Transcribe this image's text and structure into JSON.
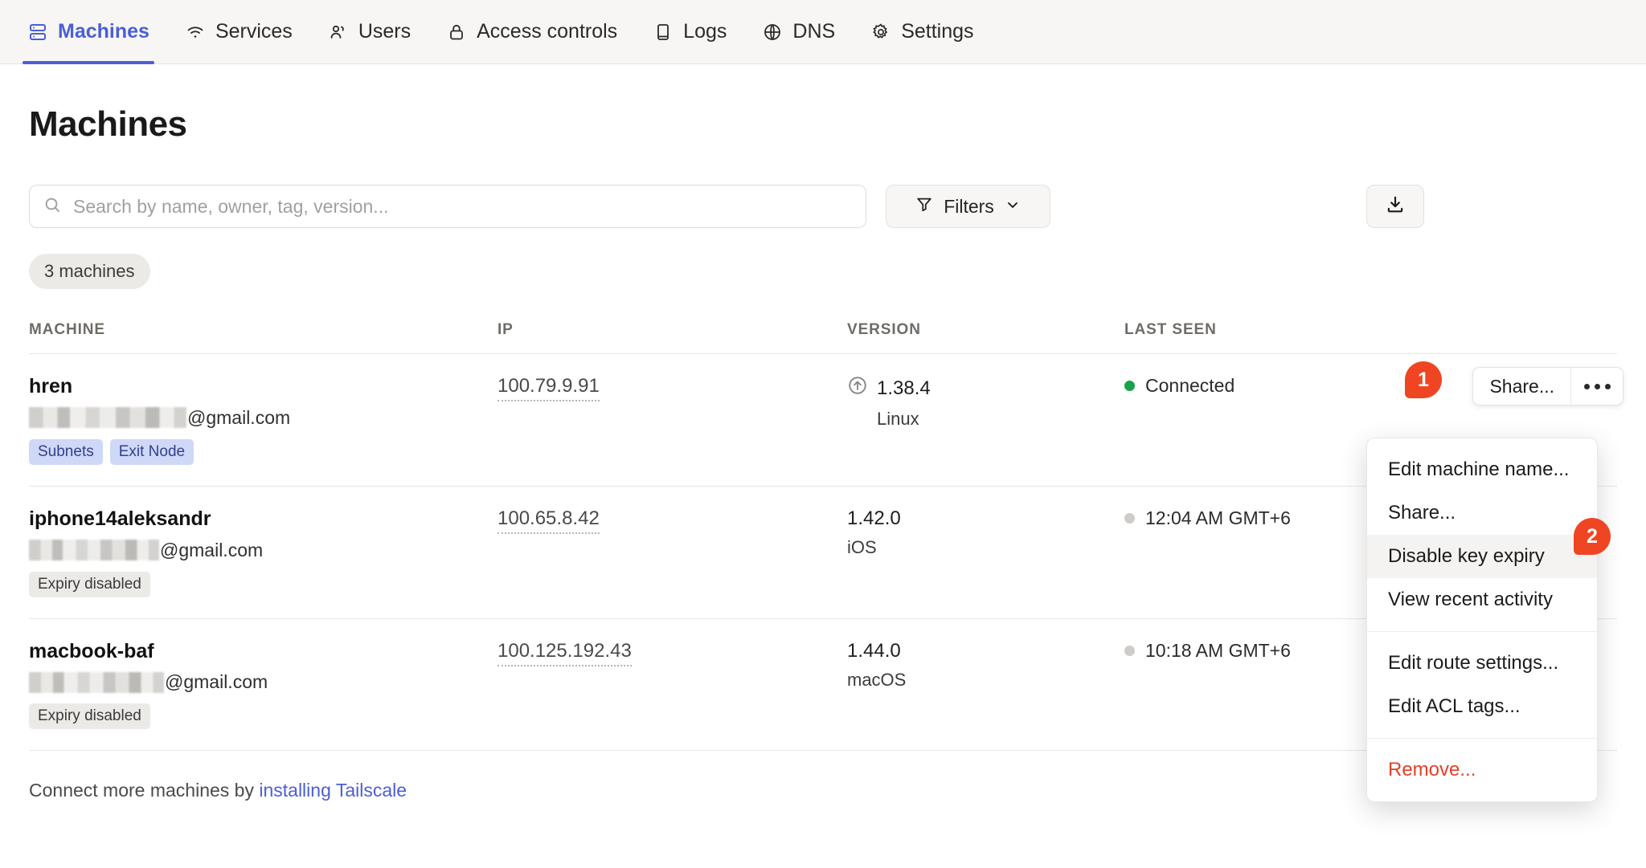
{
  "nav": {
    "items": [
      {
        "label": "Machines",
        "icon": "server-icon",
        "active": true
      },
      {
        "label": "Services",
        "icon": "wifi-icon",
        "active": false
      },
      {
        "label": "Users",
        "icon": "users-icon",
        "active": false
      },
      {
        "label": "Access controls",
        "icon": "lock-icon",
        "active": false
      },
      {
        "label": "Logs",
        "icon": "book-icon",
        "active": false
      },
      {
        "label": "DNS",
        "icon": "globe-icon",
        "active": false
      },
      {
        "label": "Settings",
        "icon": "gear-icon",
        "active": false
      }
    ],
    "accent_color": "#4b5ed7"
  },
  "page": {
    "title": "Machines"
  },
  "search": {
    "placeholder": "Search by name, owner, tag, version...",
    "value": "",
    "icon": "search-icon"
  },
  "filters": {
    "label": "Filters",
    "icon": "funnel-icon",
    "chevron": "chevron-down-icon"
  },
  "download": {
    "icon": "download-icon",
    "label": ""
  },
  "count_chip": {
    "label": "3 machines"
  },
  "table": {
    "headers": [
      "MACHINE",
      "IP",
      "VERSION",
      "LAST SEEN"
    ],
    "rows": [
      {
        "name": "hren",
        "owner_domain": "@gmail.com",
        "owner_redacted": true,
        "tags": [
          {
            "label": "Subnets",
            "style": "blue"
          },
          {
            "label": "Exit Node",
            "style": "blue"
          }
        ],
        "ip": "100.79.9.91",
        "version": "1.38.4",
        "version_update_icon": "arrow-up-circle-icon",
        "os": "Linux",
        "last_seen": "Connected",
        "status": "connected",
        "status_color": "#17a34a",
        "has_actions": true,
        "share_label": "Share..."
      },
      {
        "name": "iphone14aleksandr",
        "owner_domain": "@gmail.com",
        "owner_redacted": true,
        "tags": [
          {
            "label": "Expiry disabled",
            "style": "gray"
          }
        ],
        "ip": "100.65.8.42",
        "version": "1.42.0",
        "version_update_icon": "",
        "os": "iOS",
        "last_seen": "12:04 AM GMT+6",
        "status": "offline",
        "status_color": "#cecbc8",
        "has_actions": false,
        "share_label": ""
      },
      {
        "name": "macbook-baf",
        "owner_domain": "@gmail.com",
        "owner_redacted": true,
        "tags": [
          {
            "label": "Expiry disabled",
            "style": "gray"
          }
        ],
        "ip": "100.125.192.43",
        "version": "1.44.0",
        "version_update_icon": "",
        "os": "macOS",
        "last_seen": "10:18 AM GMT+6",
        "status": "offline",
        "status_color": "#cecbc8",
        "has_actions": false,
        "share_label": ""
      }
    ]
  },
  "menu": {
    "items": [
      {
        "label": "Edit machine name...",
        "highlight": false,
        "danger": false
      },
      {
        "label": "Share...",
        "highlight": false,
        "danger": false
      },
      {
        "label": "Disable key expiry",
        "highlight": true,
        "danger": false
      },
      {
        "label": "View recent activity",
        "highlight": false,
        "danger": false
      },
      {
        "label": "Edit route settings...",
        "highlight": false,
        "danger": false
      },
      {
        "label": "Edit ACL tags...",
        "highlight": false,
        "danger": false
      },
      {
        "label": "Remove...",
        "highlight": false,
        "danger": true
      }
    ]
  },
  "annotations": [
    {
      "number": "1",
      "target": "more-options-button",
      "color": "#f04522"
    },
    {
      "number": "2",
      "target": "menu-item-disable-key-expiry",
      "color": "#f04522"
    }
  ],
  "footer": {
    "text_before": "Connect more machines by ",
    "link_label": "installing Tailscale"
  }
}
